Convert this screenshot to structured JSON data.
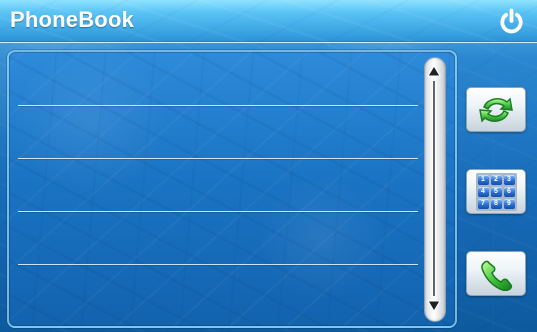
{
  "app": {
    "title": "PhoneBook"
  },
  "contacts": {
    "rows": [
      {
        "name": ""
      },
      {
        "name": ""
      },
      {
        "name": ""
      },
      {
        "name": ""
      },
      {
        "name": ""
      }
    ]
  },
  "controls": {
    "power_icon": "power-icon",
    "scroll_up_icon": "triangle-up-icon",
    "scroll_down_icon": "triangle-down-icon",
    "refresh_icon": "refresh-icon",
    "keypad_icon": "keypad-icon",
    "call_icon": "phone-call-icon"
  },
  "keypad": {
    "keys": [
      "1",
      "2",
      "3",
      "4",
      "5",
      "6",
      "7",
      "8",
      "9"
    ]
  },
  "colors": {
    "header_blue": "#59c3f5",
    "panel_blue": "#1b74c4",
    "divider": "#e6f8ff",
    "action_green": "#42b83f",
    "keypad_blue": "#2b6ed6"
  }
}
